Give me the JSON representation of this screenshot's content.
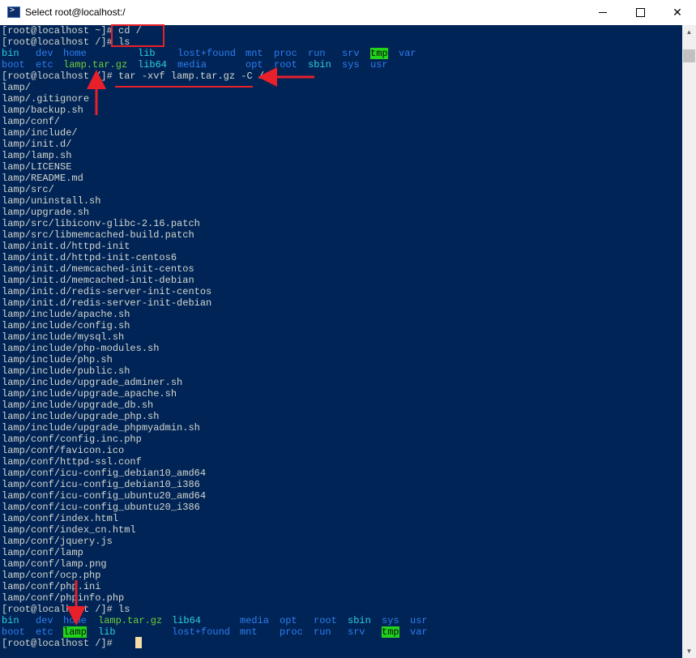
{
  "window": {
    "title": "Select root@localhost:/",
    "icon": "powershell-icon",
    "controls": {
      "minimize": "minimize-icon",
      "maximize": "maximize-icon",
      "close": "✕"
    }
  },
  "terminal": {
    "prompt_line_1": "[root@localhost ~]# cd /",
    "prompt_line_2": "[root@localhost /]# ls",
    "ls1_row1": [
      "bin",
      "dev",
      "home",
      "lib",
      "lost+found",
      "mnt",
      "proc",
      "run",
      "srv",
      "tmp",
      "var"
    ],
    "ls1_row2": [
      "boot",
      "etc",
      "lamp.tar.gz",
      "lib64",
      "media",
      "opt",
      "root",
      "sbin",
      "sys",
      "usr"
    ],
    "prompt_line_3": "[root@localhost /]# tar -xvf lamp.tar.gz -C /",
    "output": [
      "lamp/",
      "lamp/.gitignore",
      "lamp/backup.sh",
      "lamp/conf/",
      "lamp/include/",
      "lamp/init.d/",
      "lamp/lamp.sh",
      "lamp/LICENSE",
      "lamp/README.md",
      "lamp/src/",
      "lamp/uninstall.sh",
      "lamp/upgrade.sh",
      "lamp/src/libiconv-glibc-2.16.patch",
      "lamp/src/libmemcached-build.patch",
      "lamp/init.d/httpd-init",
      "lamp/init.d/httpd-init-centos6",
      "lamp/init.d/memcached-init-centos",
      "lamp/init.d/memcached-init-debian",
      "lamp/init.d/redis-server-init-centos",
      "lamp/init.d/redis-server-init-debian",
      "lamp/include/apache.sh",
      "lamp/include/config.sh",
      "lamp/include/mysql.sh",
      "lamp/include/php-modules.sh",
      "lamp/include/php.sh",
      "lamp/include/public.sh",
      "lamp/include/upgrade_adminer.sh",
      "lamp/include/upgrade_apache.sh",
      "lamp/include/upgrade_db.sh",
      "lamp/include/upgrade_php.sh",
      "lamp/include/upgrade_phpmyadmin.sh",
      "lamp/conf/config.inc.php",
      "lamp/conf/favicon.ico",
      "lamp/conf/httpd-ssl.conf",
      "lamp/conf/icu-config_debian10_amd64",
      "lamp/conf/icu-config_debian10_i386",
      "lamp/conf/icu-config_ubuntu20_amd64",
      "lamp/conf/icu-config_ubuntu20_i386",
      "lamp/conf/index.html",
      "lamp/conf/index_cn.html",
      "lamp/conf/jquery.js",
      "lamp/conf/lamp",
      "lamp/conf/lamp.png",
      "lamp/conf/ocp.php",
      "lamp/conf/php.ini",
      "lamp/conf/phpinfo.php"
    ],
    "prompt_line_4": "[root@localhost /]# ls",
    "ls2_row1": [
      "bin",
      "dev",
      "home",
      "lamp.tar.gz",
      "lib64",
      "media",
      "opt",
      "root",
      "sbin",
      "sys",
      "usr"
    ],
    "ls2_row2": [
      "boot",
      "etc",
      "lamp",
      "lib",
      "lost+found",
      "mnt",
      "proc",
      "run",
      "srv",
      "tmp",
      "var"
    ],
    "prompt_line_5": "[root@localhost /]# ",
    "colors": {
      "background": "#012456",
      "text": "#d3d7cf",
      "directory": "#2f7ef0",
      "symlink": "#2fd0d8",
      "archive": "#6fcf3a",
      "highlight": "#21d41a",
      "annotation": "#e8202a"
    }
  }
}
